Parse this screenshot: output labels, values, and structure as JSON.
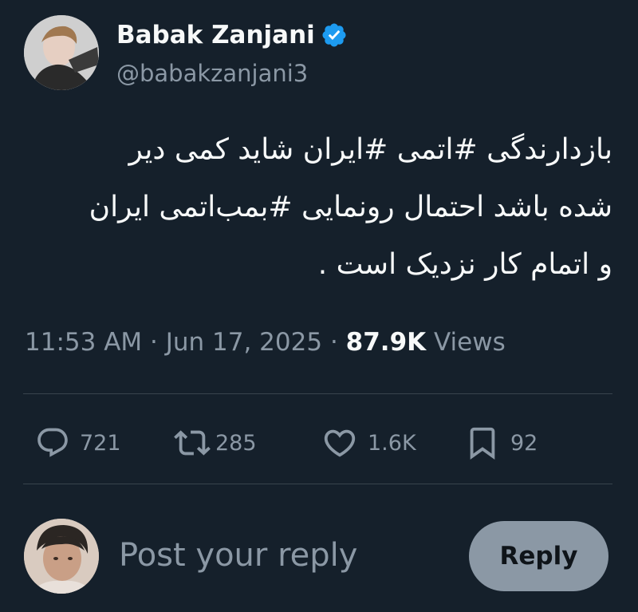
{
  "author": {
    "display_name": "Babak Zanjani",
    "handle": "@babakzanjani3",
    "verified_icon": "verified-badge-icon"
  },
  "tweet": {
    "text": "بازدارندگی #اتمی #ایران شاید کمی دیر\nشده باشد احتمال رونمایی #بمب‌اتمی ایران\nو اتمام کار نزدیک است .",
    "time": "11:53 AM",
    "separator": "·",
    "date": "Jun 17, 2025",
    "views_count": "87.9K",
    "views_label": "Views"
  },
  "actions": {
    "reply": {
      "icon": "reply-bubble-icon",
      "count": "721"
    },
    "retweet": {
      "icon": "retweet-icon",
      "count": "285"
    },
    "like": {
      "icon": "heart-icon",
      "count": "1.6K"
    },
    "bookmark": {
      "icon": "bookmark-icon",
      "count": "92"
    }
  },
  "composer": {
    "placeholder": "Post your reply",
    "button_label": "Reply"
  },
  "colors": {
    "background": "#15202b",
    "primary_text": "#f7f9f9",
    "secondary_text": "#8b98a5",
    "divider": "#38444d",
    "verified": "#1d9bf0",
    "reply_button_bg": "#8b98a5"
  }
}
